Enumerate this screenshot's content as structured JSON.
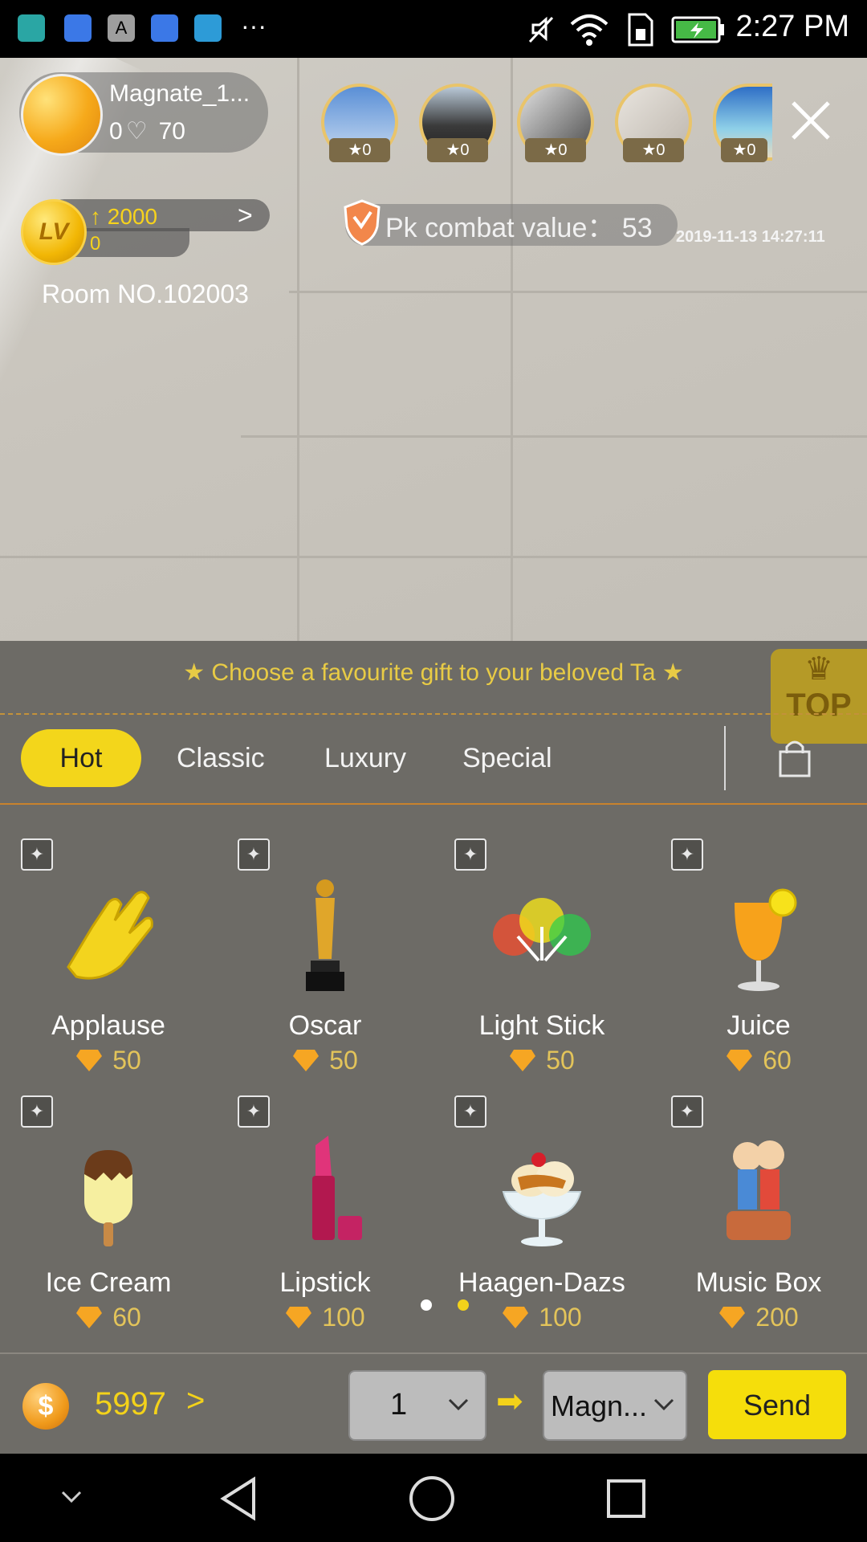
{
  "status_bar": {
    "time": "2:27 PM",
    "icons": [
      "android-icon",
      "baidu-icon",
      "a-icon",
      "baidu-icon",
      "telegram-icon",
      "more-icon",
      "mute-icon",
      "wifi-icon",
      "sim-icon",
      "battery-icon"
    ]
  },
  "host": {
    "name": "Magnate_1...",
    "likes_zero": "0",
    "likes_count": "70"
  },
  "viewers": [
    {
      "badge": "★0"
    },
    {
      "badge": "★0"
    },
    {
      "badge": "★0"
    },
    {
      "badge": "★0"
    },
    {
      "badge": "★0"
    }
  ],
  "level": {
    "badge": "LV",
    "up_value": "2000",
    "current": "0"
  },
  "room": {
    "label": "Room NO.102003"
  },
  "pk": {
    "label": "Pk combat value：  53"
  },
  "timestamp": "2019-11-13 14:27:11",
  "panel": {
    "tip": "★  Choose a favourite gift to your beloved Ta  ★",
    "top_badge": "TOP",
    "tabs": [
      "Hot",
      "Classic",
      "Luxury",
      "Special"
    ],
    "active_tab": "Hot"
  },
  "gifts": [
    {
      "name": "Applause",
      "price": "50"
    },
    {
      "name": "Oscar",
      "price": "50"
    },
    {
      "name": "Light Stick",
      "price": "50"
    },
    {
      "name": "Juice",
      "price": "60"
    },
    {
      "name": "Ice Cream",
      "price": "60"
    },
    {
      "name": "Lipstick",
      "price": "100"
    },
    {
      "name": "Haagen-Dazs",
      "price": "100"
    },
    {
      "name": "Music Box",
      "price": "200"
    }
  ],
  "bottom": {
    "coin_symbol": "$",
    "balance": "5997",
    "quantity": "1",
    "recipient": "Magn...",
    "send_label": "Send"
  },
  "colors": {
    "accent_yellow": "#f5de0b",
    "gold_text": "#e3c45a",
    "panel_bg": "#6d6b66"
  }
}
